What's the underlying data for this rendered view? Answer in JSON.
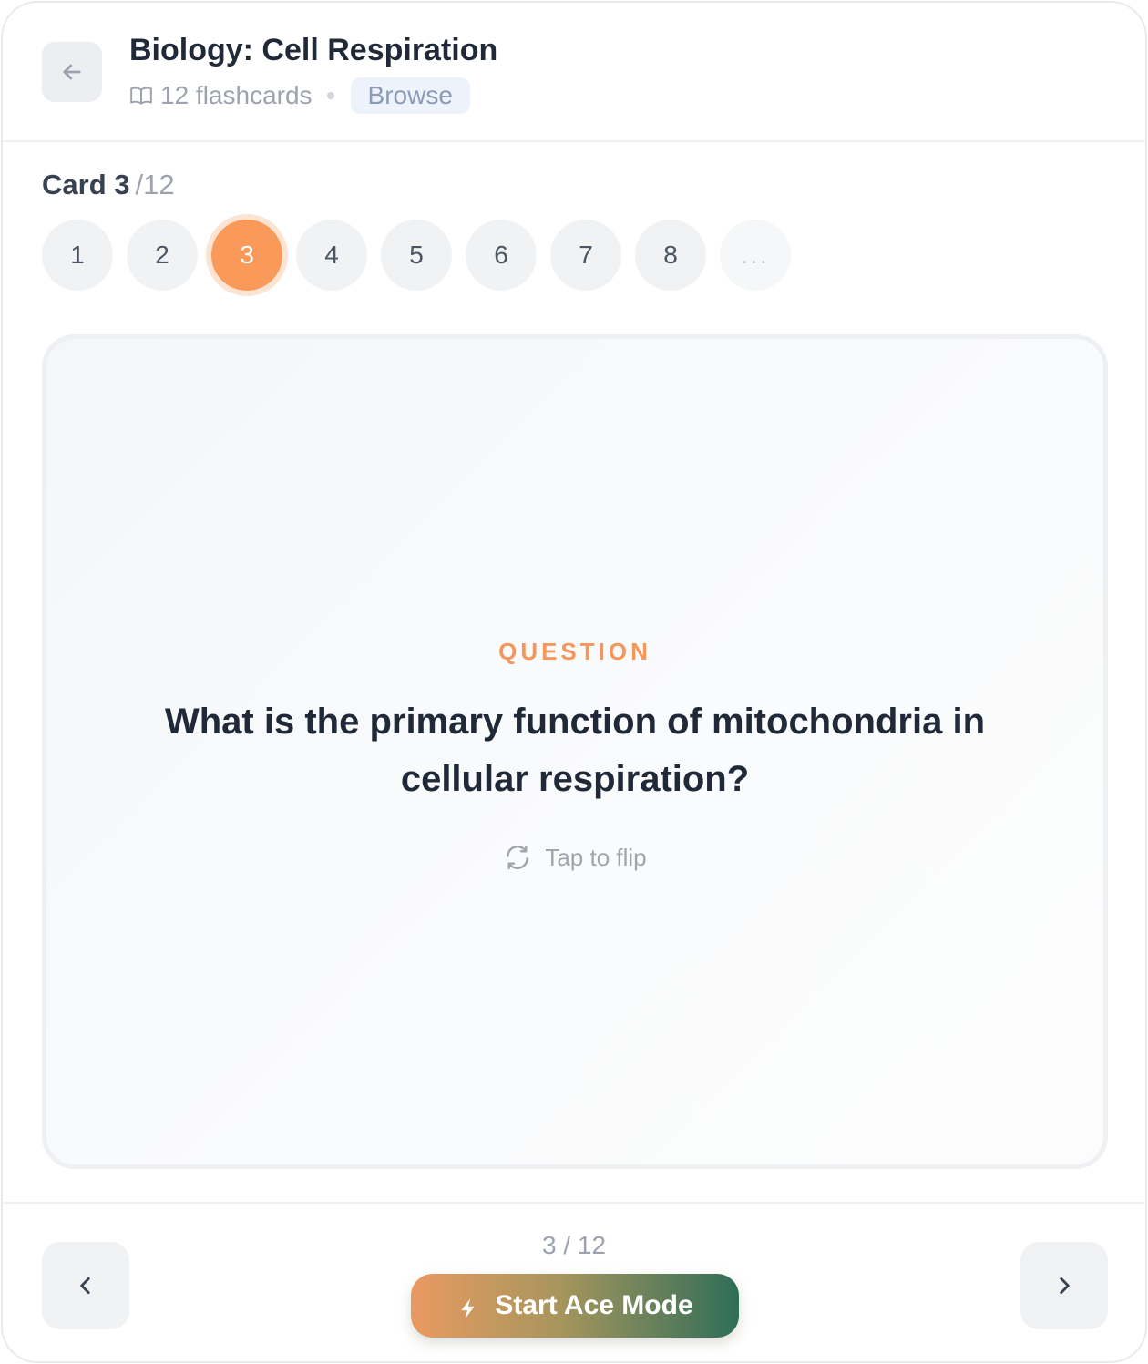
{
  "header": {
    "back_icon": "arrow-left-icon",
    "title": "Biology: Cell Respiration",
    "book_icon": "book-open-icon",
    "card_count": "12 flashcards",
    "mode_badge": "Browse"
  },
  "counter": {
    "label": "Card 3",
    "total": "/12"
  },
  "pager": {
    "items": [
      "1",
      "2",
      "3",
      "4",
      "5",
      "6",
      "7",
      "8"
    ],
    "active_index": 2,
    "more": "...",
    "active_color": "#f9995a"
  },
  "card": {
    "kind": "QUESTION",
    "text": "What is the primary function of mitochondria in cellular respiration?",
    "hint": "Tap to flip",
    "hint_icon": "refresh-icon",
    "accent_color": "#f4975c"
  },
  "footer": {
    "progress": "3 / 12",
    "ace_label": "Start Ace Mode",
    "ace_icon": "lightning-bolt-icon",
    "prev_icon": "chevron-left-icon",
    "next_icon": "chevron-right-icon"
  }
}
